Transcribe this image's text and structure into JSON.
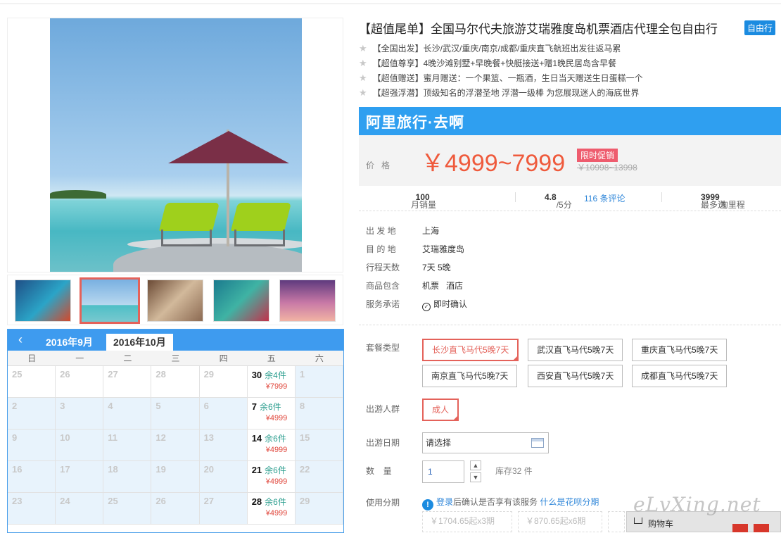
{
  "product": {
    "title": "【超值尾单】全国马尔代夫旅游艾瑞雅度岛机票酒店代理全包自由行",
    "badge": "自由行",
    "features": [
      "【全国出发】长沙/武汉/重庆/南京/成都/重庆直飞航班出发往返马累",
      "【超值尊享】4晚沙滩别墅+早晚餐+快艇接送+赠1晚民居岛含早餐",
      "【超值赠送】蜜月赠送：一个果篮、一瓶酒，生日当天赠送生日蛋糕一个",
      "【超强浮潜】顶级知名的浮潜圣地 浮潜一级棒 为您展现迷人的海底世界"
    ],
    "star_icon": "star-icon"
  },
  "brand": {
    "name": "阿里旅行·去啊",
    "color": "#2f9ff0"
  },
  "price": {
    "label": "价格",
    "value": "￥4999~7999",
    "promo": "限时促销",
    "original": "￥10998~13998",
    "accent": "#ef5a3c"
  },
  "stats": {
    "monthly_sales_label": "月销量",
    "monthly_sales": "100",
    "rating": "4.8",
    "rating_suffix": "/5分",
    "reviews": "116 条评论",
    "points_prefix": "最多送",
    "points": "3999",
    "points_suffix": "淘里程"
  },
  "info": [
    {
      "key": "出 发 地",
      "value": "上海"
    },
    {
      "key": "目 的 地",
      "value": "艾瑞雅度岛"
    },
    {
      "key": "行程天数",
      "value": "7天 5晚"
    },
    {
      "key": "商品包含",
      "value": "机票   酒店"
    },
    {
      "key": "服务承诺",
      "value": "即时确认"
    }
  ],
  "package": {
    "label": "套餐类型",
    "options": [
      "长沙直飞马代5晚7天",
      "武汉直飞马代5晚7天",
      "重庆直飞马代5晚7天",
      "南京直飞马代5晚7天",
      "西安直飞马代5晚7天",
      "成都直飞马代5晚7天"
    ],
    "selected": "长沙直飞马代5晚7天"
  },
  "traveler": {
    "label": "出游人群",
    "option": "成人"
  },
  "date": {
    "label": "出游日期",
    "value": "请选择"
  },
  "quantity": {
    "label": "数  量",
    "value": "1",
    "stock": "库存32 件"
  },
  "installment": {
    "label": "使用分期",
    "login": "登录",
    "text": "后确认是否享有该服务",
    "link": "什么是花呗分期",
    "options": [
      "￥1704.65起x3期",
      "￥870.65起x6期"
    ]
  },
  "cart": {
    "label": "购物车"
  },
  "watermark": "eLvXing.net",
  "calendar": {
    "prev_icon": "chevron-left-icon",
    "months": [
      "2016年9月",
      "2016年10月"
    ],
    "active_month": "2016年10月",
    "weekdays": [
      "日",
      "一",
      "二",
      "三",
      "四",
      "五",
      "六"
    ],
    "weeks": [
      [
        {
          "d": "25",
          "t": "prev"
        },
        {
          "d": "26",
          "t": "prev"
        },
        {
          "d": "27",
          "t": "prev"
        },
        {
          "d": "28",
          "t": "prev"
        },
        {
          "d": "29",
          "t": "prev"
        },
        {
          "d": "30",
          "t": "avail",
          "stock": "余4件",
          "price": "¥7999"
        },
        {
          "d": "1",
          "t": "off"
        }
      ],
      [
        {
          "d": "2",
          "t": "off"
        },
        {
          "d": "3",
          "t": "off"
        },
        {
          "d": "4",
          "t": "off"
        },
        {
          "d": "5",
          "t": "off"
        },
        {
          "d": "6",
          "t": "off"
        },
        {
          "d": "7",
          "t": "avail",
          "stock": "余6件",
          "price": "¥4999"
        },
        {
          "d": "8",
          "t": "off"
        }
      ],
      [
        {
          "d": "9",
          "t": "off"
        },
        {
          "d": "10",
          "t": "off"
        },
        {
          "d": "11",
          "t": "off"
        },
        {
          "d": "12",
          "t": "off"
        },
        {
          "d": "13",
          "t": "off"
        },
        {
          "d": "14",
          "t": "avail",
          "stock": "余6件",
          "price": "¥4999"
        },
        {
          "d": "15",
          "t": "off"
        }
      ],
      [
        {
          "d": "16",
          "t": "off"
        },
        {
          "d": "17",
          "t": "off"
        },
        {
          "d": "18",
          "t": "off"
        },
        {
          "d": "19",
          "t": "off"
        },
        {
          "d": "20",
          "t": "off"
        },
        {
          "d": "21",
          "t": "avail",
          "stock": "余6件",
          "price": "¥4999"
        },
        {
          "d": "22",
          "t": "off"
        }
      ],
      [
        {
          "d": "23",
          "t": "off"
        },
        {
          "d": "24",
          "t": "off"
        },
        {
          "d": "25",
          "t": "off"
        },
        {
          "d": "26",
          "t": "off"
        },
        {
          "d": "27",
          "t": "off"
        },
        {
          "d": "28",
          "t": "avail",
          "stock": "余6件",
          "price": "¥4999"
        },
        {
          "d": "29",
          "t": "off"
        }
      ]
    ]
  }
}
